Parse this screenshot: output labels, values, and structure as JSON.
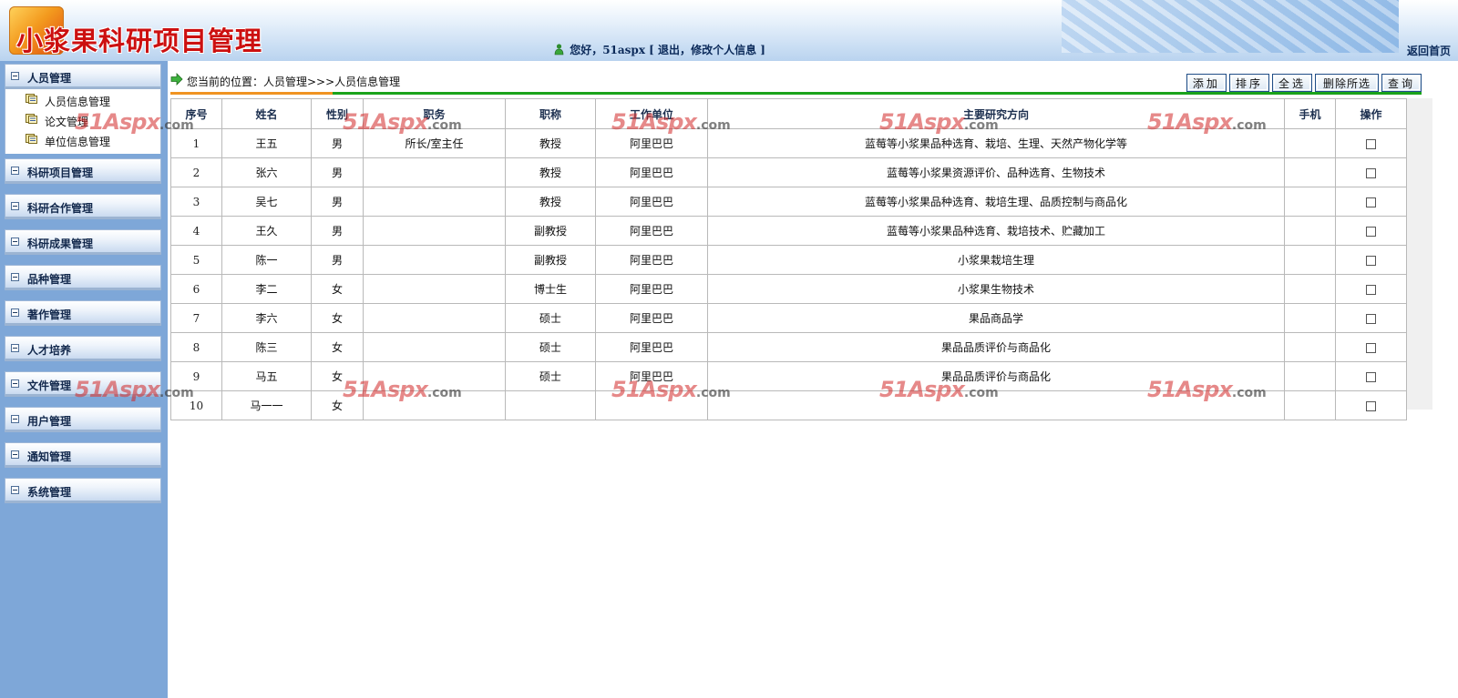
{
  "app": {
    "title": "小浆果科研项目管理",
    "greeting_prefix": "您好，",
    "username": "51aspx",
    "greeting_bracket_open": " [ ",
    "logout": "退出",
    "sep": "，",
    "edit_profile": "修改个人信息",
    "greeting_bracket_close": " ]",
    "home_link": "返回首页"
  },
  "sidebar": {
    "groups": [
      {
        "label": "人员管理",
        "expanded": true,
        "items": [
          {
            "label": "人员信息管理"
          },
          {
            "label": "论文管理"
          },
          {
            "label": "单位信息管理"
          }
        ]
      },
      {
        "label": "科研项目管理"
      },
      {
        "label": "科研合作管理"
      },
      {
        "label": "科研成果管理"
      },
      {
        "label": "品种管理"
      },
      {
        "label": "著作管理"
      },
      {
        "label": "人才培养"
      },
      {
        "label": "文件管理"
      },
      {
        "label": "用户管理"
      },
      {
        "label": "通知管理"
      },
      {
        "label": "系统管理"
      }
    ]
  },
  "breadcrumb": {
    "text": "您当前的位置：人员管理>>>人员信息管理"
  },
  "toolbar": {
    "add": "添加",
    "sort": "排序",
    "select_all": "全选",
    "delete_selected": "删除所选",
    "query": "查询"
  },
  "table": {
    "columns": [
      "序号",
      "姓名",
      "性别",
      "职务",
      "职称",
      "工作单位",
      "主要研究方向",
      "手机",
      "操作"
    ],
    "rows": [
      {
        "no": "1",
        "name": "王五",
        "gender": "男",
        "duty": "所长/室主任",
        "title": "教授",
        "org": "阿里巴巴",
        "research": "蓝莓等小浆果品种选育、栽培、生理、天然产物化学等",
        "phone": ""
      },
      {
        "no": "2",
        "name": "张六",
        "gender": "男",
        "duty": "",
        "title": "教授",
        "org": "阿里巴巴",
        "research": "蓝莓等小浆果资源评价、品种选育、生物技术",
        "phone": ""
      },
      {
        "no": "3",
        "name": "吴七",
        "gender": "男",
        "duty": "",
        "title": "教授",
        "org": "阿里巴巴",
        "research": "蓝莓等小浆果品种选育、栽培生理、品质控制与商品化",
        "phone": ""
      },
      {
        "no": "4",
        "name": "王久",
        "gender": "男",
        "duty": "",
        "title": "副教授",
        "org": "阿里巴巴",
        "research": "蓝莓等小浆果品种选育、栽培技术、贮藏加工",
        "phone": ""
      },
      {
        "no": "5",
        "name": "陈一",
        "gender": "男",
        "duty": "",
        "title": "副教授",
        "org": "阿里巴巴",
        "research": "小浆果栽培生理",
        "phone": ""
      },
      {
        "no": "6",
        "name": "李二",
        "gender": "女",
        "duty": "",
        "title": "博士生",
        "org": "阿里巴巴",
        "research": "小浆果生物技术",
        "phone": ""
      },
      {
        "no": "7",
        "name": "李六",
        "gender": "女",
        "duty": "",
        "title": "硕士",
        "org": "阿里巴巴",
        "research": "果品商品学",
        "phone": ""
      },
      {
        "no": "8",
        "name": "陈三",
        "gender": "女",
        "duty": "",
        "title": "硕士",
        "org": "阿里巴巴",
        "research": "果品品质评价与商品化",
        "phone": ""
      },
      {
        "no": "9",
        "name": "马五",
        "gender": "女",
        "duty": "",
        "title": "硕士",
        "org": "阿里巴巴",
        "research": "果品品质评价与商品化",
        "phone": ""
      },
      {
        "no": "10",
        "name": "马一一",
        "gender": "女",
        "duty": "",
        "title": "",
        "org": "",
        "research": "",
        "phone": ""
      }
    ]
  },
  "watermark": {
    "brand": "51Aspx",
    "domain": ".com"
  },
  "colors": {
    "sidebar_bg": "#7ea7d8",
    "title_red": "#cc1010",
    "crumb_green": "#1aa31a",
    "crumb_orange": "#f09321"
  }
}
